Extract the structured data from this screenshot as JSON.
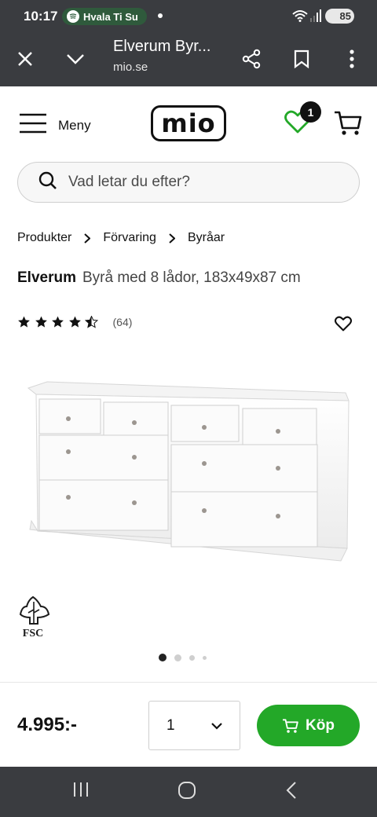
{
  "status": {
    "time": "10:17",
    "media": "Hvala Ti Su",
    "battery": "85"
  },
  "browser": {
    "title": "Elverum Byr...",
    "url": "mio.se"
  },
  "header": {
    "menu_label": "Meny",
    "logo": "mio",
    "wishlist_count": "1"
  },
  "search": {
    "placeholder": "Vad letar du efter?"
  },
  "breadcrumb": [
    "Produkter",
    "Förvaring",
    "Byråar"
  ],
  "product": {
    "brand": "Elverum",
    "description": "Byrå med 8 lådor, 183x49x87 cm",
    "rating": 4.5,
    "rating_max": 5,
    "review_count": "(64)",
    "cert_label": "FSC",
    "image_count": 4,
    "active_image": 1
  },
  "buy": {
    "price": "4.995:-",
    "quantity": "1",
    "button_label": "Köp"
  },
  "colors": {
    "accent_green": "#23a828",
    "chrome": "#3a3c40"
  }
}
